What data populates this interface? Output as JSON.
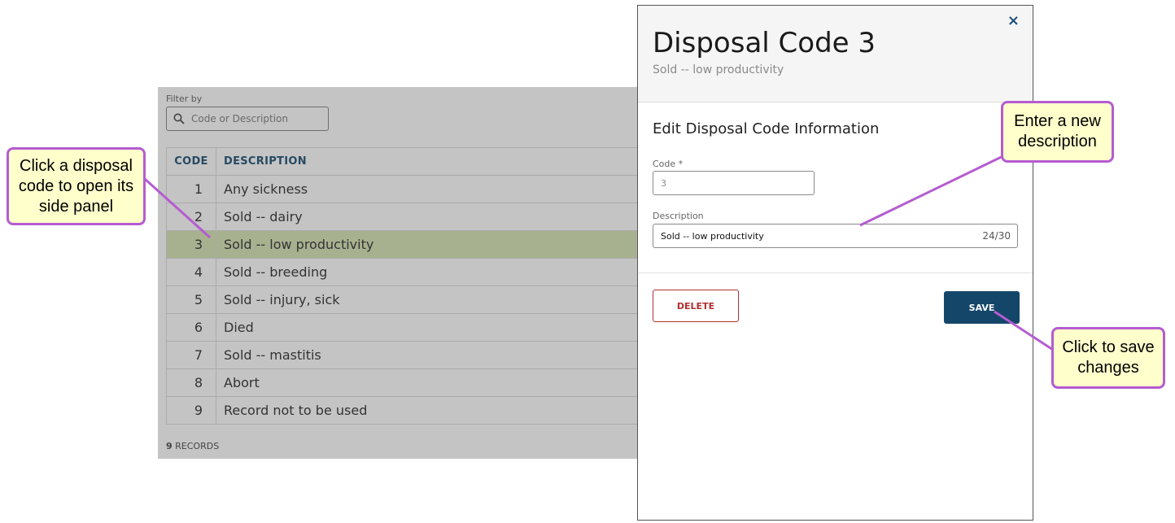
{
  "filter": {
    "label": "Filter by",
    "placeholder": "Code or Description",
    "icon": "search-icon"
  },
  "table": {
    "headers": {
      "code": "CODE",
      "description": "DESCRIPTION"
    },
    "rows": [
      {
        "code": "1",
        "description": "Any sickness"
      },
      {
        "code": "2",
        "description": "Sold -- dairy"
      },
      {
        "code": "3",
        "description": "Sold -- low productivity"
      },
      {
        "code": "4",
        "description": "Sold -- breeding"
      },
      {
        "code": "5",
        "description": "Sold -- injury, sick"
      },
      {
        "code": "6",
        "description": "Died"
      },
      {
        "code": "7",
        "description": "Sold -- mastitis"
      },
      {
        "code": "8",
        "description": "Abort"
      },
      {
        "code": "9",
        "description": "Record not to be used"
      }
    ],
    "selected_row": 3,
    "records_count": "9",
    "records_label": "RECORDS"
  },
  "panel": {
    "close_icon": "×",
    "title": "Disposal Code 3",
    "subtitle": "Sold -- low productivity",
    "section_title": "Edit Disposal Code Information",
    "code_label": "Code *",
    "code_value": "3",
    "description_label": "Description",
    "description_value": "Sold -- low productivity",
    "description_count": "24/30",
    "delete_label": "DELETE",
    "save_label": "SAVE"
  },
  "callouts": {
    "row": "Click a disposal code to open its side panel",
    "description": "Enter a new description",
    "save": "Click to save changes"
  },
  "colors": {
    "accent": "#14466a",
    "delete": "#b03030",
    "selected_row": "#a7b18f",
    "callout_border": "#b55cd1",
    "callout_fill": "#ffffcc"
  }
}
